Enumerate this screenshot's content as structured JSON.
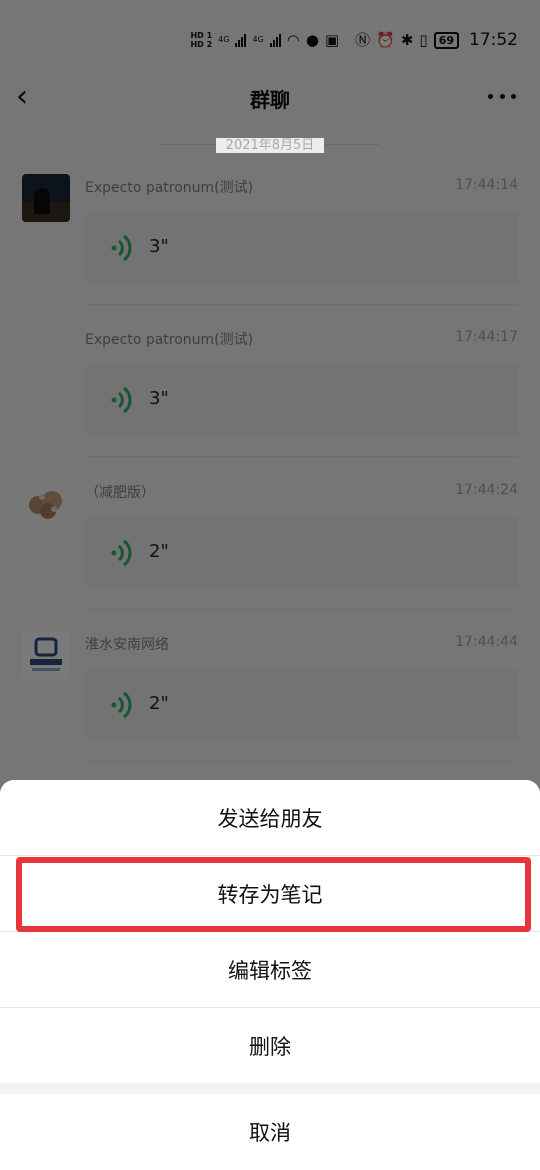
{
  "status_bar": {
    "hd1": "HD 1",
    "hd2": "HD 2",
    "net1": "4G",
    "net2": "4G",
    "battery": "69",
    "time": "17:52"
  },
  "nav": {
    "title": "群聊"
  },
  "chat": {
    "date": "2021年8月5日",
    "messages": [
      {
        "name": "Expecto patronum(测试)",
        "time": "17:44:14",
        "duration": "3\""
      },
      {
        "name": "Expecto patronum(测试)",
        "time": "17:44:17",
        "duration": "3\""
      },
      {
        "name": "（减肥版）",
        "time": "17:44:24",
        "duration": "2\""
      },
      {
        "name": "淮水安南网络",
        "time": "17:44:44",
        "duration": "2\""
      }
    ]
  },
  "action_sheet": {
    "items": [
      {
        "label": "发送给朋友"
      },
      {
        "label": "转存为笔记"
      },
      {
        "label": "编辑标签"
      },
      {
        "label": "删除"
      }
    ],
    "cancel": "取消"
  },
  "colors": {
    "highlight": "#e8353b",
    "voice_green": "#2aae67"
  }
}
